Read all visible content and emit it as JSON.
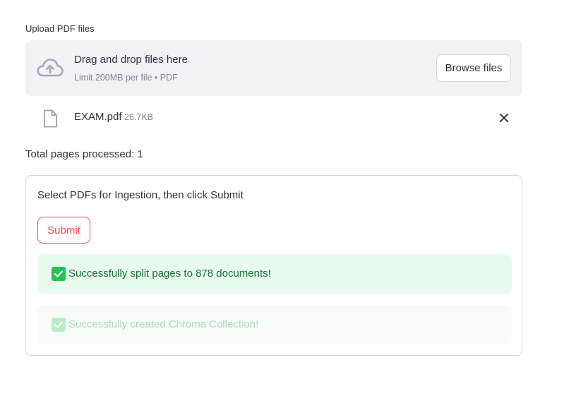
{
  "uploader": {
    "label": "Upload PDF files",
    "drop_title": "Drag and drop files here",
    "drop_subtitle": "Limit 200MB per file • PDF",
    "browse_label": "Browse files",
    "icon": "cloud-upload-icon"
  },
  "file": {
    "name": "EXAM.pdf",
    "size": "26.7KB",
    "icon": "file-icon",
    "remove_icon": "close-icon"
  },
  "total_pages": "Total pages processed: 1",
  "form": {
    "title": "Select PDFs for Ingestion, then click Submit",
    "submit_label": "Submit",
    "alerts": [
      {
        "text": "Successfully split pages to 878 documents!",
        "icon": "check-icon"
      },
      {
        "text": "Successfully created Chroma Collection!",
        "icon": "check-icon"
      }
    ]
  },
  "colors": {
    "accent": "#ff4b4b",
    "success": "#21c354",
    "success_text": "#177233",
    "dropzone_bg": "#f0f2f6"
  }
}
